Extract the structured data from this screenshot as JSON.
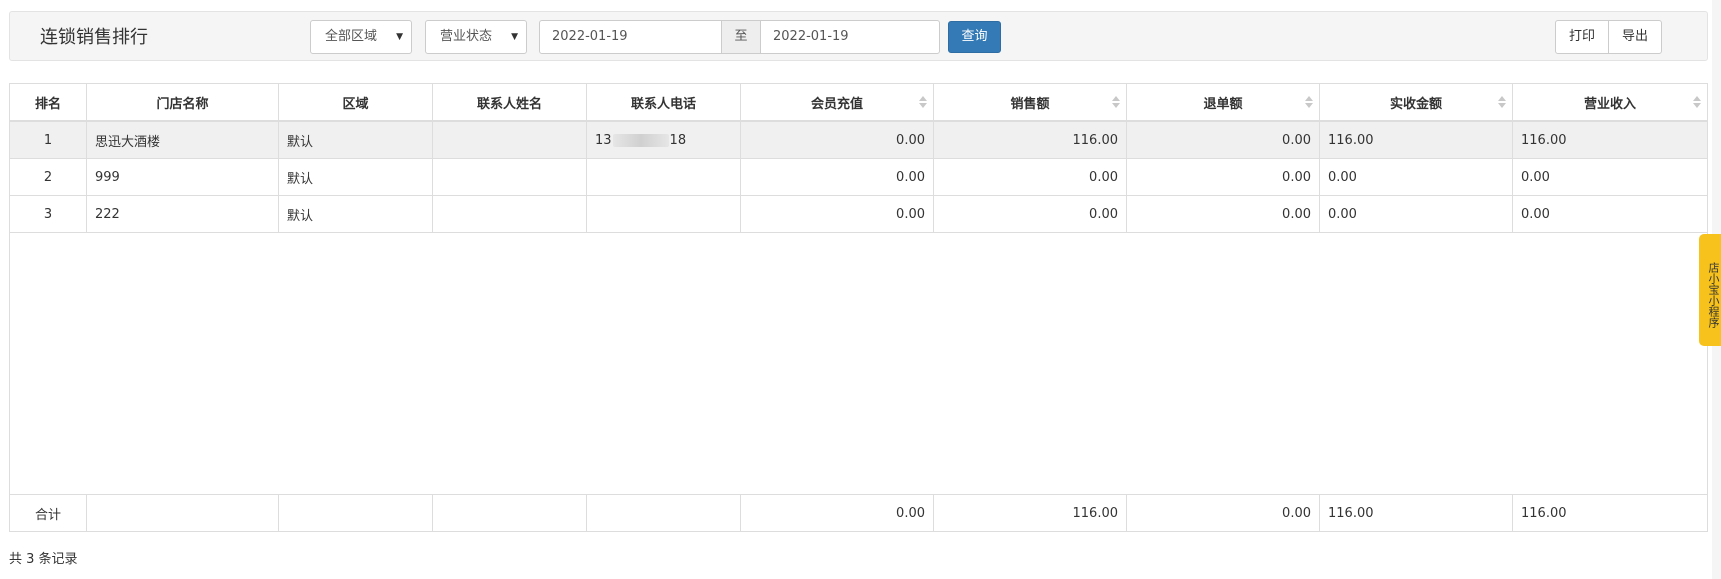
{
  "header": {
    "title": "连锁销售排行",
    "region_select": "全部区域",
    "status_select": "营业状态",
    "date_from": "2022-01-19",
    "date_sep": "至",
    "date_to": "2022-01-19",
    "query_label": "查询",
    "print_label": "打印",
    "export_label": "导出"
  },
  "table": {
    "columns": [
      "排名",
      "门店名称",
      "区域",
      "联系人姓名",
      "联系人电话",
      "会员充值",
      "销售额",
      "退单额",
      "实收金额",
      "营业收入"
    ],
    "rows": [
      {
        "rank": "1",
        "store": "思迅大酒楼",
        "area": "默认",
        "contact": "",
        "phone_start": "13",
        "phone_end": "18",
        "recharge": "0.00",
        "sales": "116.00",
        "refund": "0.00",
        "received": "116.00",
        "income": "116.00"
      },
      {
        "rank": "2",
        "store": "999",
        "area": "默认",
        "contact": "",
        "phone_start": "",
        "phone_end": "",
        "recharge": "0.00",
        "sales": "0.00",
        "refund": "0.00",
        "received": "0.00",
        "income": "0.00"
      },
      {
        "rank": "3",
        "store": "222",
        "area": "默认",
        "contact": "",
        "phone_start": "",
        "phone_end": "",
        "recharge": "0.00",
        "sales": "0.00",
        "refund": "0.00",
        "received": "0.00",
        "income": "0.00"
      }
    ],
    "total": {
      "label": "合计",
      "recharge": "0.00",
      "sales": "116.00",
      "refund": "0.00",
      "received": "116.00",
      "income": "116.00"
    }
  },
  "footer": {
    "count_text": "共 3 条记录"
  },
  "side_tab": {
    "label": "店小宝小程序"
  },
  "colors": {
    "primary": "#337ab7",
    "side_tab": "#f7c21b"
  }
}
